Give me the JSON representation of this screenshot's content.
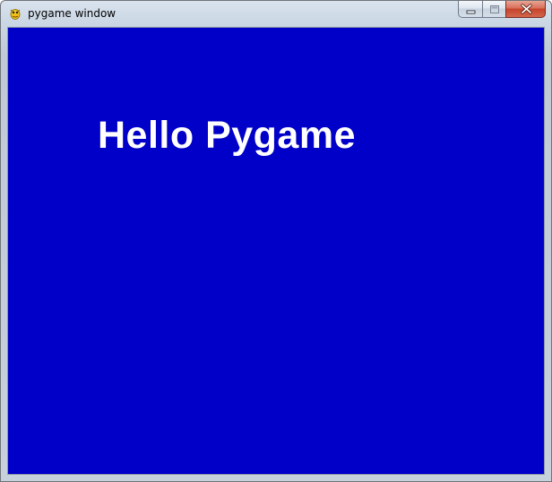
{
  "window": {
    "title": "pygame window",
    "app_icon": "pygame-snake-icon",
    "controls": {
      "minimize_icon": "minimize-icon",
      "maximize_icon": "maximize-icon",
      "close_icon": "close-icon"
    }
  },
  "canvas": {
    "background_color": "#0000c8",
    "text": "Hello Pygame",
    "text_color": "#ffffff"
  }
}
